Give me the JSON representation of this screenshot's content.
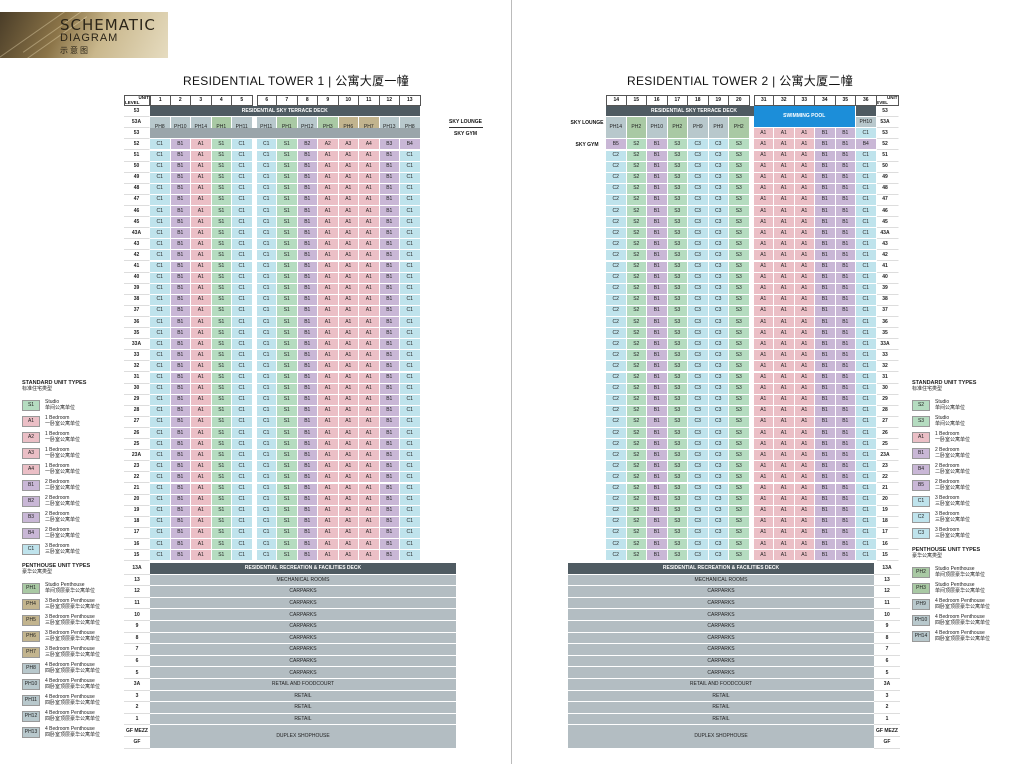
{
  "header": {
    "title_line1": "SCHEMATIC",
    "title_line2": "DIAGRAM",
    "title_zh": "示意图"
  },
  "tower1": {
    "title": "RESIDENTIAL TOWER 1 | 公寓大厦一幢",
    "unit_label": "UNIT",
    "level_label": "LEVEL",
    "columns": [
      "1",
      "2",
      "3",
      "4",
      "5",
      "6",
      "7",
      "8",
      "9",
      "10",
      "11",
      "12",
      "13"
    ],
    "sky_deck": "RESIDENTIAL SKY TERRACE DECK",
    "sky_lounge": "SKY LOUNGE",
    "sky_gym": "SKY GYM",
    "row53A": [
      "PH8",
      "PH10",
      "PH14",
      "PH1",
      "PH11",
      "PH11",
      "PH1",
      "PH12",
      "PH3",
      "PH6",
      "PH7",
      "PH13",
      "PH8"
    ],
    "row52": [
      "C1",
      "B1",
      "A1",
      "S1",
      "C1",
      "C1",
      "S1",
      "B2",
      "A2",
      "A3",
      "A4",
      "B3",
      "B4"
    ],
    "standard_row": [
      "C1",
      "B1",
      "A1",
      "S1",
      "C1",
      "C1",
      "S1",
      "B1",
      "A1",
      "A1",
      "A1",
      "B1",
      "C1"
    ]
  },
  "tower2": {
    "title": "RESIDENTIAL TOWER 2 | 公寓大厦二幢",
    "unit_label": "UNIT",
    "level_label": "LEVEL",
    "columns": [
      "14",
      "15",
      "16",
      "17",
      "18",
      "19",
      "20",
      "31",
      "32",
      "33",
      "34",
      "35",
      "36"
    ],
    "sky_deck": "RESIDENTIAL SKY TERRACE DECK",
    "pool": "SWIMMING POOL",
    "sky_lounge": "SKY LOUNGE",
    "sky_gym": "SKY GYM",
    "row53A": [
      "PH14",
      "PH2",
      "PH10",
      "PH2",
      "PH9",
      "PH9",
      "PH2",
      "",
      "",
      "",
      "",
      "",
      "PH10"
    ],
    "row53": [
      "",
      "",
      "",
      "",
      "",
      "",
      "",
      "A1",
      "A1",
      "A1",
      "B1",
      "B1",
      "C1"
    ],
    "row52": [
      "B5",
      "S2",
      "B1",
      "S3",
      "C3",
      "C3",
      "S3",
      "A1",
      "A1",
      "A1",
      "B1",
      "B1",
      "B4"
    ],
    "standard_row": [
      "C2",
      "S2",
      "B1",
      "S3",
      "C3",
      "C3",
      "S3",
      "A1",
      "A1",
      "A1",
      "B1",
      "B1",
      "C1"
    ]
  },
  "levels": [
    "53",
    "53A",
    "53",
    "52",
    "51",
    "50",
    "49",
    "48",
    "47",
    "46",
    "45",
    "43A",
    "43",
    "42",
    "41",
    "40",
    "39",
    "38",
    "37",
    "36",
    "35",
    "33A",
    "33",
    "32",
    "31",
    "30",
    "29",
    "28",
    "27",
    "26",
    "25",
    "23A",
    "23",
    "22",
    "21",
    "20",
    "19",
    "18",
    "17",
    "16",
    "15"
  ],
  "podium": [
    {
      "level": "13A",
      "label": "RESIDENTIAL RECREATION & FACILITIES DECK",
      "dark": true
    },
    {
      "level": "13",
      "label": "MECHANICAL ROOMS"
    },
    {
      "level": "12",
      "label": "CARPARKS"
    },
    {
      "level": "11",
      "label": "CARPARKS"
    },
    {
      "level": "10",
      "label": "CARPARKS"
    },
    {
      "level": "9",
      "label": "CARPARKS"
    },
    {
      "level": "8",
      "label": "CARPARKS"
    },
    {
      "level": "7",
      "label": "CARPARKS"
    },
    {
      "level": "6",
      "label": "CARPARKS"
    },
    {
      "level": "5",
      "label": "CARPARKS"
    },
    {
      "level": "3A",
      "label": "RETAIL AND FOODCOURT"
    },
    {
      "level": "3",
      "label": "RETAIL"
    },
    {
      "level": "2",
      "label": "RETAIL"
    },
    {
      "level": "1",
      "label": "RETAIL"
    },
    {
      "level": "GF MEZZ",
      "label": "DUPLEX SHOPHOUSE",
      "double": true
    },
    {
      "level": "GF",
      "label": ""
    }
  ],
  "legend_left": {
    "standard_title": "STANDARD UNIT TYPES",
    "standard_title_zh": "标准住宅类型",
    "standard": [
      {
        "code": "S1",
        "en": "Studio",
        "zh": "单间公寓单位"
      },
      {
        "code": "A1",
        "en": "1 Bedroom",
        "zh": "一卧室公寓单位"
      },
      {
        "code": "A2",
        "en": "1 Bedroom",
        "zh": "一卧室公寓单位"
      },
      {
        "code": "A3",
        "en": "1 Bedroom",
        "zh": "一卧室公寓单位"
      },
      {
        "code": "A4",
        "en": "1 Bedroom",
        "zh": "一卧室公寓单位"
      },
      {
        "code": "B1",
        "en": "2 Bedroom",
        "zh": "二卧室公寓单位"
      },
      {
        "code": "B2",
        "en": "2 Bedroom",
        "zh": "二卧室公寓单位"
      },
      {
        "code": "B3",
        "en": "2 Bedroom",
        "zh": "二卧室公寓单位"
      },
      {
        "code": "B4",
        "en": "2 Bedroom",
        "zh": "二卧室公寓单位"
      },
      {
        "code": "C1",
        "en": "3 Bedroom",
        "zh": "三卧室公寓单位"
      }
    ],
    "penthouse_title": "PENTHOUSE UNIT TYPES",
    "penthouse_title_zh": "豪华公寓类型",
    "penthouse": [
      {
        "code": "PH1",
        "en": "Studio Penthouse",
        "zh": "单间顶层豪华公寓单位"
      },
      {
        "code": "PH4",
        "en": "3 Bedroom Penthouse",
        "zh": "三卧室顶层豪华公寓单位"
      },
      {
        "code": "PH5",
        "en": "3 Bedroom Penthouse",
        "zh": "三卧室顶层豪华公寓单位"
      },
      {
        "code": "PH6",
        "en": "3 Bedroom Penthouse",
        "zh": "三卧室顶层豪华公寓单位"
      },
      {
        "code": "PH7",
        "en": "3 Bedroom Penthouse",
        "zh": "三卧室顶层豪华公寓单位"
      },
      {
        "code": "PH8",
        "en": "4 Bedroom Penthouse",
        "zh": "四卧室顶层豪华公寓单位"
      },
      {
        "code": "PH10",
        "en": "4 Bedroom Penthouse",
        "zh": "四卧室顶层豪华公寓单位"
      },
      {
        "code": "PH11",
        "en": "4 Bedroom Penthouse",
        "zh": "四卧室顶层豪华公寓单位"
      },
      {
        "code": "PH12",
        "en": "4 Bedroom Penthouse",
        "zh": "四卧室顶层豪华公寓单位"
      },
      {
        "code": "PH13",
        "en": "4 Bedroom Penthouse",
        "zh": "四卧室顶层豪华公寓单位"
      }
    ]
  },
  "legend_right": {
    "standard_title": "STANDARD UNIT TYPES",
    "standard_title_zh": "标准住宅类型",
    "standard": [
      {
        "code": "S2",
        "en": "Studio",
        "zh": "单间公寓单位"
      },
      {
        "code": "S3",
        "en": "Studio",
        "zh": "单间公寓单位"
      },
      {
        "code": "A1",
        "en": "1 Bedroom",
        "zh": "一卧室公寓单位"
      },
      {
        "code": "B1",
        "en": "2 Bedroom",
        "zh": "二卧室公寓单位"
      },
      {
        "code": "B4",
        "en": "2 Bedroom",
        "zh": "二卧室公寓单位"
      },
      {
        "code": "B5",
        "en": "2 Bedroom",
        "zh": "二卧室公寓单位"
      },
      {
        "code": "C1",
        "en": "3 Bedroom",
        "zh": "三卧室公寓单位"
      },
      {
        "code": "C2",
        "en": "3 Bedroom",
        "zh": "三卧室公寓单位"
      },
      {
        "code": "C3",
        "en": "3 Bedroom",
        "zh": "三卧室公寓单位"
      }
    ],
    "penthouse_title": "PENTHOUSE UNIT TYPES",
    "penthouse_title_zh": "豪华公寓类型",
    "penthouse": [
      {
        "code": "PH2",
        "en": "Studio Penthouse",
        "zh": "单间顶层豪华公寓单位"
      },
      {
        "code": "PH3",
        "en": "Studio Penthouse",
        "zh": "单间顶层豪华公寓单位"
      },
      {
        "code": "PH9",
        "en": "4 Bedroom Penthouse",
        "zh": "四卧室顶层豪华公寓单位"
      },
      {
        "code": "PH10",
        "en": "4 Bedroom Penthouse",
        "zh": "四卧室顶层豪华公寓单位"
      },
      {
        "code": "PH14",
        "en": "4 Bedroom Penthouse",
        "zh": "四卧室顶层豪华公寓单位"
      }
    ]
  }
}
